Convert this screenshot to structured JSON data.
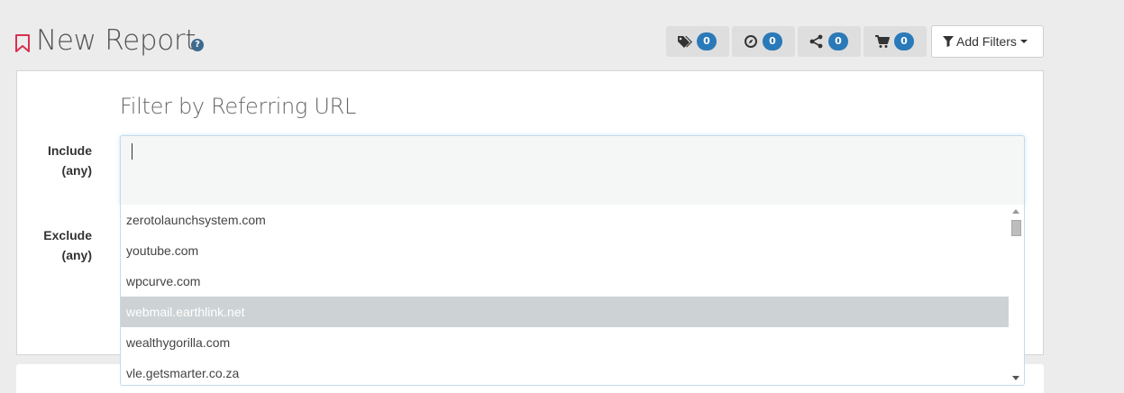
{
  "header": {
    "title": "New Report",
    "help_label": "?",
    "counters": [
      {
        "icon": "tags-icon",
        "count": "0"
      },
      {
        "icon": "compass-icon",
        "count": "0"
      },
      {
        "icon": "share-icon",
        "count": "0"
      },
      {
        "icon": "cart-icon",
        "count": "0"
      }
    ],
    "add_filters_label": "Add Filters"
  },
  "filter": {
    "heading": "Filter by Referring URL",
    "include_label": "Include",
    "include_sub": "(any)",
    "exclude_label": "Exclude",
    "exclude_sub": "(any)",
    "include_value": "",
    "options": [
      "zerotolaunchsystem.com",
      "youtube.com",
      "wpcurve.com",
      "webmail.earthlink.net",
      "wealthygorilla.com",
      "vle.getsmarter.co.za"
    ],
    "highlighted_index": 3
  },
  "colors": {
    "badge": "#2a79b8",
    "bookmark": "#d8304f",
    "highlight": "#cdd3d4"
  }
}
